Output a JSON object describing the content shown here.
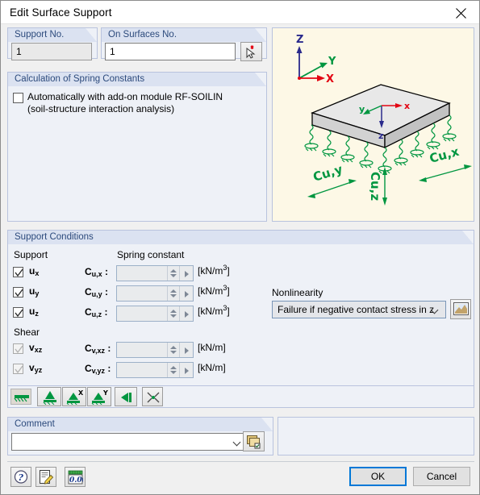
{
  "window": {
    "title": "Edit Surface Support",
    "close_icon": "close-icon"
  },
  "support_no": {
    "legend": "Support No.",
    "value": "1"
  },
  "on_surfaces": {
    "legend": "On Surfaces No.",
    "value": "1",
    "pick_button_icon": "pick-from-graphic-icon"
  },
  "spring_constants": {
    "legend": "Calculation of Spring Constants",
    "checkbox": {
      "checked": false,
      "line1": "Automatically with add-on module RF-SOILIN",
      "line2": "(soil-structure interaction analysis)"
    }
  },
  "support_conditions": {
    "legend": "Support Conditions",
    "col_support": "Support",
    "col_spring": "Spring constant",
    "rows": [
      {
        "name": "u",
        "sub": "x",
        "checked": true,
        "enabled": true,
        "const_label": "C",
        "const_sub": "u,x",
        "value": "",
        "unit_main": "[kN/m",
        "unit_sup": "3",
        "unit_end": "]"
      },
      {
        "name": "u",
        "sub": "y",
        "checked": true,
        "enabled": true,
        "const_label": "C",
        "const_sub": "u,y",
        "value": "",
        "unit_main": "[kN/m",
        "unit_sup": "3",
        "unit_end": "]"
      },
      {
        "name": "u",
        "sub": "z",
        "checked": true,
        "enabled": true,
        "const_label": "C",
        "const_sub": "u,z",
        "value": "",
        "unit_main": "[kN/m",
        "unit_sup": "3",
        "unit_end": "]"
      }
    ],
    "shear_title": "Shear",
    "shear_rows": [
      {
        "name": "v",
        "sub": "xz",
        "checked": true,
        "enabled": false,
        "const_label": "C",
        "const_sub": "v,xz",
        "value": "",
        "unit_main": "[kN/m",
        "unit_sup": "",
        "unit_end": "]"
      },
      {
        "name": "v",
        "sub": "yz",
        "checked": true,
        "enabled": false,
        "const_label": "C",
        "const_sub": "v,yz",
        "value": "",
        "unit_main": "[kN/m",
        "unit_sup": "",
        "unit_end": "]"
      }
    ],
    "nonlinearity_label": "Nonlinearity",
    "nonlinearity_value": "Failure if negative contact stress in z",
    "nonlinearity_button_icon": "diagram-picture-icon"
  },
  "support_toolbar": {
    "buttons": [
      {
        "icon": "elastic-foundation-icon",
        "active": true
      },
      {
        "icon": "rigid-support-icon",
        "active": false
      },
      {
        "icon": "support-x-icon",
        "active": false
      },
      {
        "icon": "support-y-icon",
        "active": false
      },
      {
        "icon": "shear-wall-icon",
        "active": false
      },
      {
        "icon": "free-support-icon",
        "active": false
      }
    ]
  },
  "comment": {
    "legend": "Comment",
    "value": "",
    "placeholder": "",
    "library_button_icon": "comment-library-icon"
  },
  "footer": {
    "icons": [
      {
        "icon": "help-icon"
      },
      {
        "icon": "edit-notes-icon"
      },
      {
        "icon": "units-decimal-icon"
      }
    ],
    "ok_label": "OK",
    "cancel_label": "Cancel"
  },
  "graphic": {
    "axis_z": "Z",
    "axis_y": "Y",
    "axis_x": "X",
    "local_x": "x",
    "local_y": "y",
    "local_z": "z",
    "label_cux": "Cu,x",
    "label_cuy": "Cu,y",
    "label_cuz": "Cu,z"
  },
  "colors": {
    "accent_blue": "#0078d7",
    "group_header": "#dbe2f1",
    "group_bg": "#eef1f7",
    "graphic_bg": "#fdf8e6",
    "spring_green": "#009640",
    "axis_red": "#e30613",
    "axis_blue": "#2a2a8c"
  }
}
